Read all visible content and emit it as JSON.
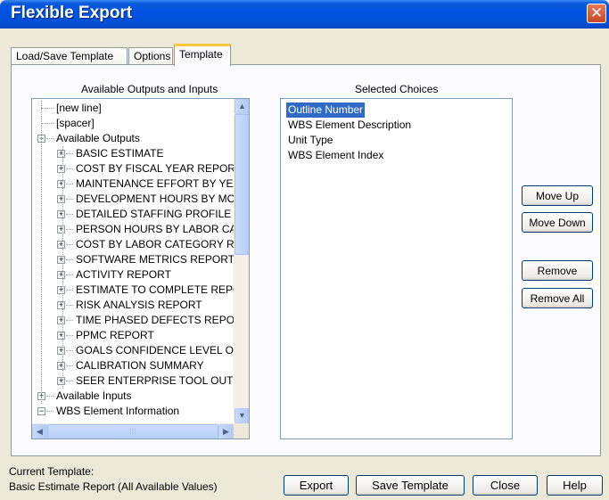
{
  "window": {
    "title": "Flexible Export",
    "close_symbol": "✕"
  },
  "tabs": [
    {
      "label": "Load/Save Template",
      "active": false
    },
    {
      "label": "Options",
      "active": false
    },
    {
      "label": "Template",
      "active": true
    }
  ],
  "left_panel": {
    "heading": "Available Outputs and Inputs",
    "tree": [
      {
        "label": "[new line]",
        "level": 0,
        "expander": "",
        "selected": true
      },
      {
        "label": "[spacer]",
        "level": 0,
        "expander": ""
      },
      {
        "label": "Available Outputs",
        "level": 0,
        "expander": "−"
      },
      {
        "label": "BASIC ESTIMATE",
        "level": 1,
        "expander": "+"
      },
      {
        "label": "COST BY FISCAL YEAR REPORT",
        "level": 1,
        "expander": "+"
      },
      {
        "label": "MAINTENANCE EFFORT BY YEAR",
        "level": 1,
        "expander": "+"
      },
      {
        "label": "DEVELOPMENT HOURS BY MONT",
        "level": 1,
        "expander": "+"
      },
      {
        "label": "DETAILED STAFFING PROFILE RE",
        "level": 1,
        "expander": "+"
      },
      {
        "label": "PERSON HOURS BY LABOR CATE",
        "level": 1,
        "expander": "+"
      },
      {
        "label": "COST BY LABOR CATEGORY REP",
        "level": 1,
        "expander": "+"
      },
      {
        "label": "SOFTWARE METRICS REPORT",
        "level": 1,
        "expander": "+"
      },
      {
        "label": "ACTIVITY REPORT",
        "level": 1,
        "expander": "+"
      },
      {
        "label": "ESTIMATE TO COMPLETE REPO...",
        "level": 1,
        "expander": "+"
      },
      {
        "label": "RISK ANALYSIS REPORT",
        "level": 1,
        "expander": "+"
      },
      {
        "label": "TIME PHASED DEFECTS REPO...",
        "level": 1,
        "expander": "+"
      },
      {
        "label": "PPMC REPORT",
        "level": 1,
        "expander": "+"
      },
      {
        "label": "GOALS CONFIDENCE LEVEL OUTI",
        "level": 1,
        "expander": "+"
      },
      {
        "label": "CALIBRATION SUMMARY",
        "level": 1,
        "expander": "+"
      },
      {
        "label": "SEER ENTERPRISE TOOL OUTPUL",
        "level": 1,
        "expander": "+"
      },
      {
        "label": "Available Inputs",
        "level": 0,
        "expander": "+"
      },
      {
        "label": "WBS Element Information",
        "level": 0,
        "expander": "−"
      }
    ],
    "scroll_up": "▲",
    "scroll_down": "▼",
    "scroll_left": "◀",
    "scroll_right": "▶",
    "thumb_grip": "⁞⁞⁞"
  },
  "right_panel": {
    "heading": "Selected Choices",
    "items": [
      {
        "label": "Outline Number",
        "selected": true
      },
      {
        "label": "WBS Element Description"
      },
      {
        "label": "Unit Type"
      },
      {
        "label": "WBS Element Index"
      }
    ]
  },
  "side_buttons": {
    "move_up": "Move Up",
    "move_down": "Move Down",
    "remove": "Remove",
    "remove_all": "Remove All"
  },
  "footer": {
    "current_template_label": "Current Template:",
    "current_template_value": "Basic Estimate Report (All Available Values)",
    "export": "Export",
    "save_template": "Save Template",
    "close": "Close",
    "help": "Help"
  }
}
